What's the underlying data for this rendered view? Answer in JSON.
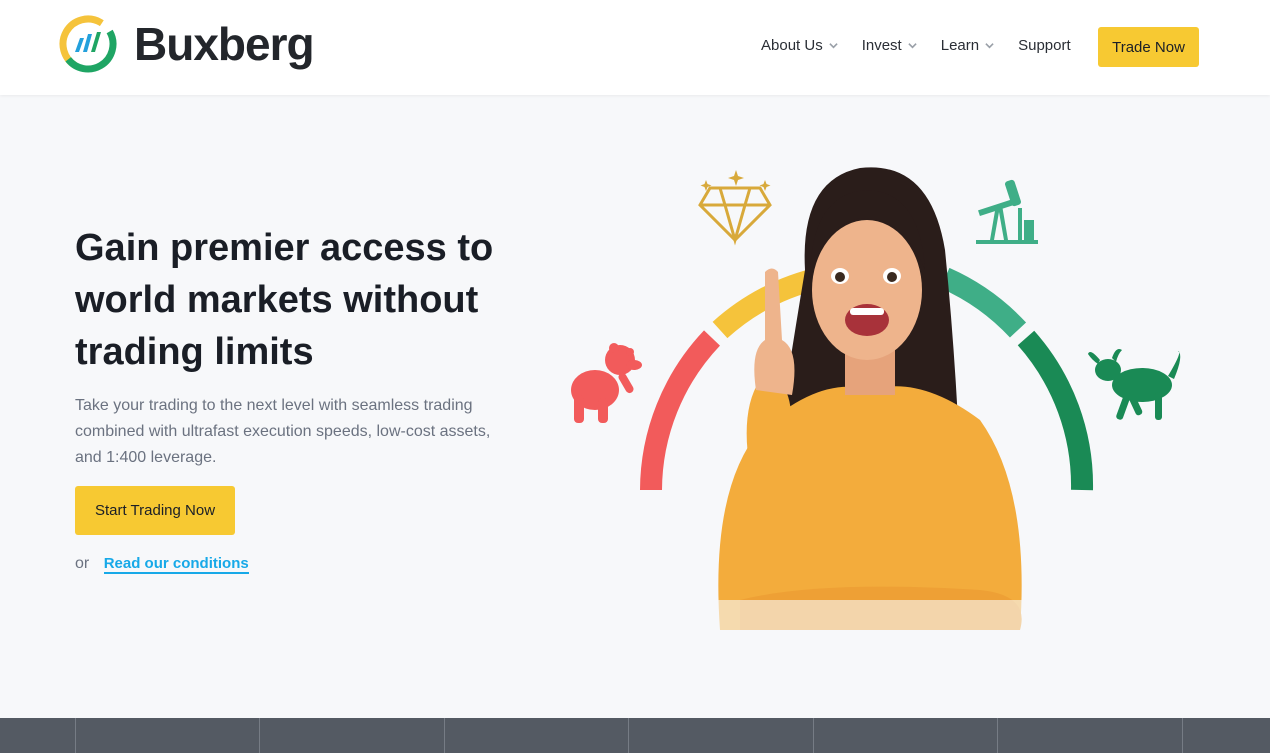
{
  "header": {
    "brand": "Buxberg",
    "nav": [
      {
        "label": "About Us",
        "has_dropdown": true
      },
      {
        "label": "Invest",
        "has_dropdown": true
      },
      {
        "label": "Learn",
        "has_dropdown": true
      },
      {
        "label": "Support",
        "has_dropdown": false
      }
    ],
    "cta_label": "Trade Now"
  },
  "hero": {
    "title": "Gain premier access to world markets without trading limits",
    "subtitle": "Take your trading to the next level with seamless trading combined with ultrafast execution speeds, low-cost assets, and 1:400 leverage.",
    "primary_button": "Start Trading Now",
    "or_text": "or",
    "conditions_link": "Read our conditions"
  },
  "illustration": {
    "icons": [
      "diamond-icon",
      "oil-pump-icon",
      "bear-icon",
      "bull-icon"
    ],
    "gauge_colors": [
      "#f25b5b",
      "#f5c33b",
      "#3fae87",
      "#1a8a55"
    ]
  },
  "colors": {
    "accent": "#f7c932",
    "link": "#17a9e8",
    "ticker_bg": "#545a63"
  }
}
